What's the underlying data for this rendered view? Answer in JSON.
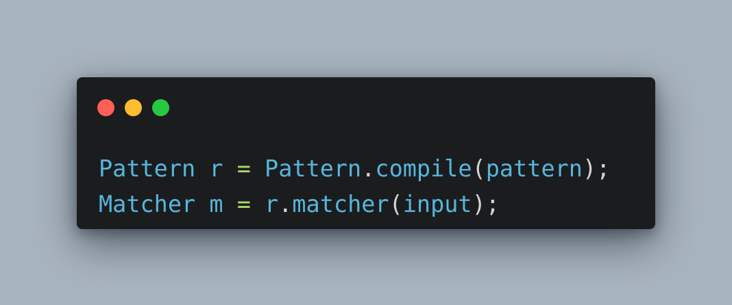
{
  "window": {
    "controls": [
      {
        "name": "close",
        "color": "#ff5f57"
      },
      {
        "name": "minimize",
        "color": "#febc2e"
      },
      {
        "name": "maximize",
        "color": "#28c840"
      }
    ],
    "background": "#1b1c1e"
  },
  "page": {
    "background": "#a8b4be"
  },
  "colors": {
    "identifier": "#56b6dd",
    "operator": "#a6d96a",
    "punctuation": "#d4d4d4"
  },
  "code": {
    "lines": [
      {
        "tokens": [
          {
            "text": "Pattern",
            "kind": "ident"
          },
          {
            "text": " ",
            "kind": "space"
          },
          {
            "text": "r",
            "kind": "ident"
          },
          {
            "text": " ",
            "kind": "space"
          },
          {
            "text": "=",
            "kind": "op"
          },
          {
            "text": " ",
            "kind": "space"
          },
          {
            "text": "Pattern",
            "kind": "ident"
          },
          {
            "text": ".",
            "kind": "punct"
          },
          {
            "text": "compile",
            "kind": "ident"
          },
          {
            "text": "(",
            "kind": "punct"
          },
          {
            "text": "pattern",
            "kind": "ident"
          },
          {
            "text": ");",
            "kind": "punct"
          }
        ]
      },
      {
        "tokens": [
          {
            "text": "Matcher",
            "kind": "ident"
          },
          {
            "text": " ",
            "kind": "space"
          },
          {
            "text": "m",
            "kind": "ident"
          },
          {
            "text": " ",
            "kind": "space"
          },
          {
            "text": "=",
            "kind": "op"
          },
          {
            "text": " ",
            "kind": "space"
          },
          {
            "text": "r",
            "kind": "ident"
          },
          {
            "text": ".",
            "kind": "punct"
          },
          {
            "text": "matcher",
            "kind": "ident"
          },
          {
            "text": "(",
            "kind": "punct"
          },
          {
            "text": "input",
            "kind": "ident"
          },
          {
            "text": ");",
            "kind": "punct"
          }
        ]
      }
    ]
  }
}
